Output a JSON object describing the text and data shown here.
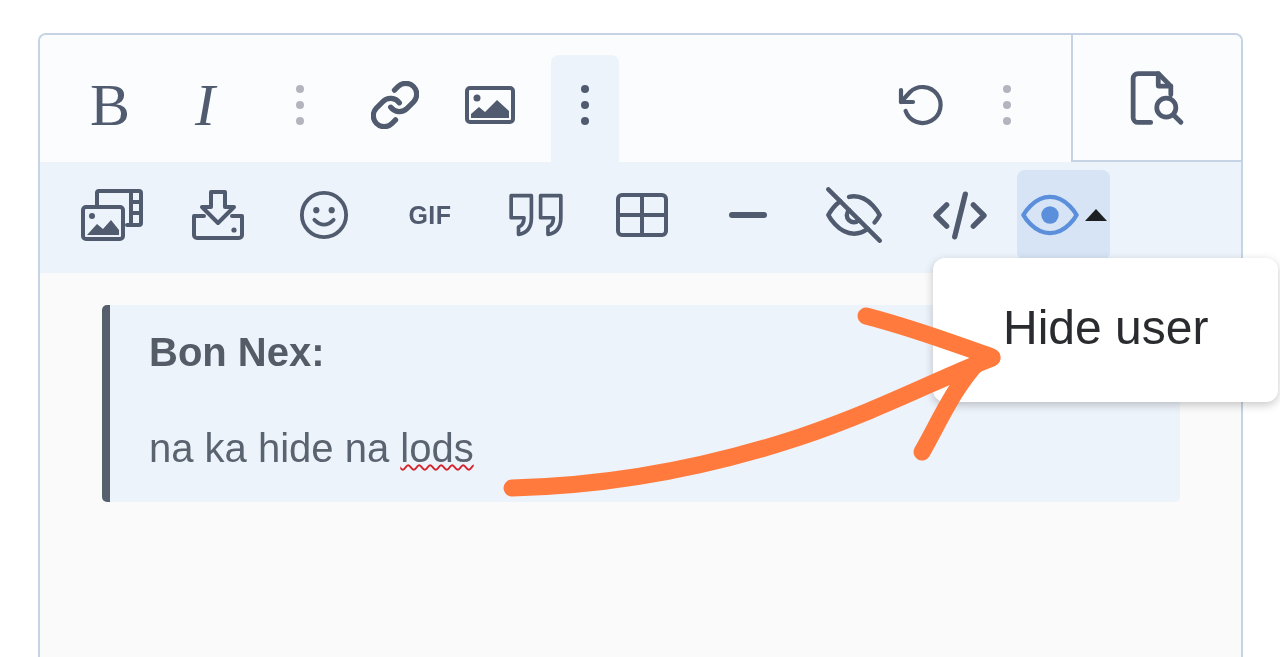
{
  "editor": {
    "toolbar": {
      "start": [
        {
          "kind": "bold",
          "label": "B",
          "expanded": false,
          "disabled": false
        },
        {
          "kind": "italic",
          "label": "I",
          "expanded": false,
          "disabled": false
        },
        {
          "kind": "more",
          "expanded": false,
          "disabled": true
        },
        {
          "kind": "link",
          "expanded": false,
          "disabled": false
        },
        {
          "kind": "image",
          "expanded": false,
          "disabled": false
        },
        {
          "kind": "more",
          "expanded": true,
          "disabled": false
        }
      ],
      "end": [
        {
          "kind": "undo",
          "expanded": false,
          "disabled": false
        },
        {
          "kind": "more",
          "expanded": false,
          "disabled": true
        }
      ]
    },
    "expanded_toolbar": [
      {
        "kind": "media",
        "expanded": false,
        "dropdown": false
      },
      {
        "kind": "attach",
        "expanded": false,
        "dropdown": false
      },
      {
        "kind": "emoji",
        "expanded": false,
        "dropdown": false
      },
      {
        "kind": "gif",
        "label": "GIF",
        "expanded": false,
        "dropdown": false
      },
      {
        "kind": "quote",
        "expanded": false,
        "dropdown": false
      },
      {
        "kind": "table",
        "expanded": false,
        "dropdown": false
      },
      {
        "kind": "rule",
        "expanded": false,
        "dropdown": false
      },
      {
        "kind": "spoiler",
        "expanded": false,
        "dropdown": false
      },
      {
        "kind": "code",
        "expanded": false,
        "dropdown": false
      },
      {
        "kind": "hide",
        "expanded": true,
        "dropdown": true
      }
    ],
    "quote": {
      "author": "Bon Nex:",
      "body": [
        {
          "text": "na ka hide na ",
          "misspelled": false
        },
        {
          "text": "lods",
          "misspelled": true
        }
      ]
    }
  },
  "menu": {
    "items": [
      {
        "label": "Hide user",
        "selected": false
      }
    ]
  }
}
